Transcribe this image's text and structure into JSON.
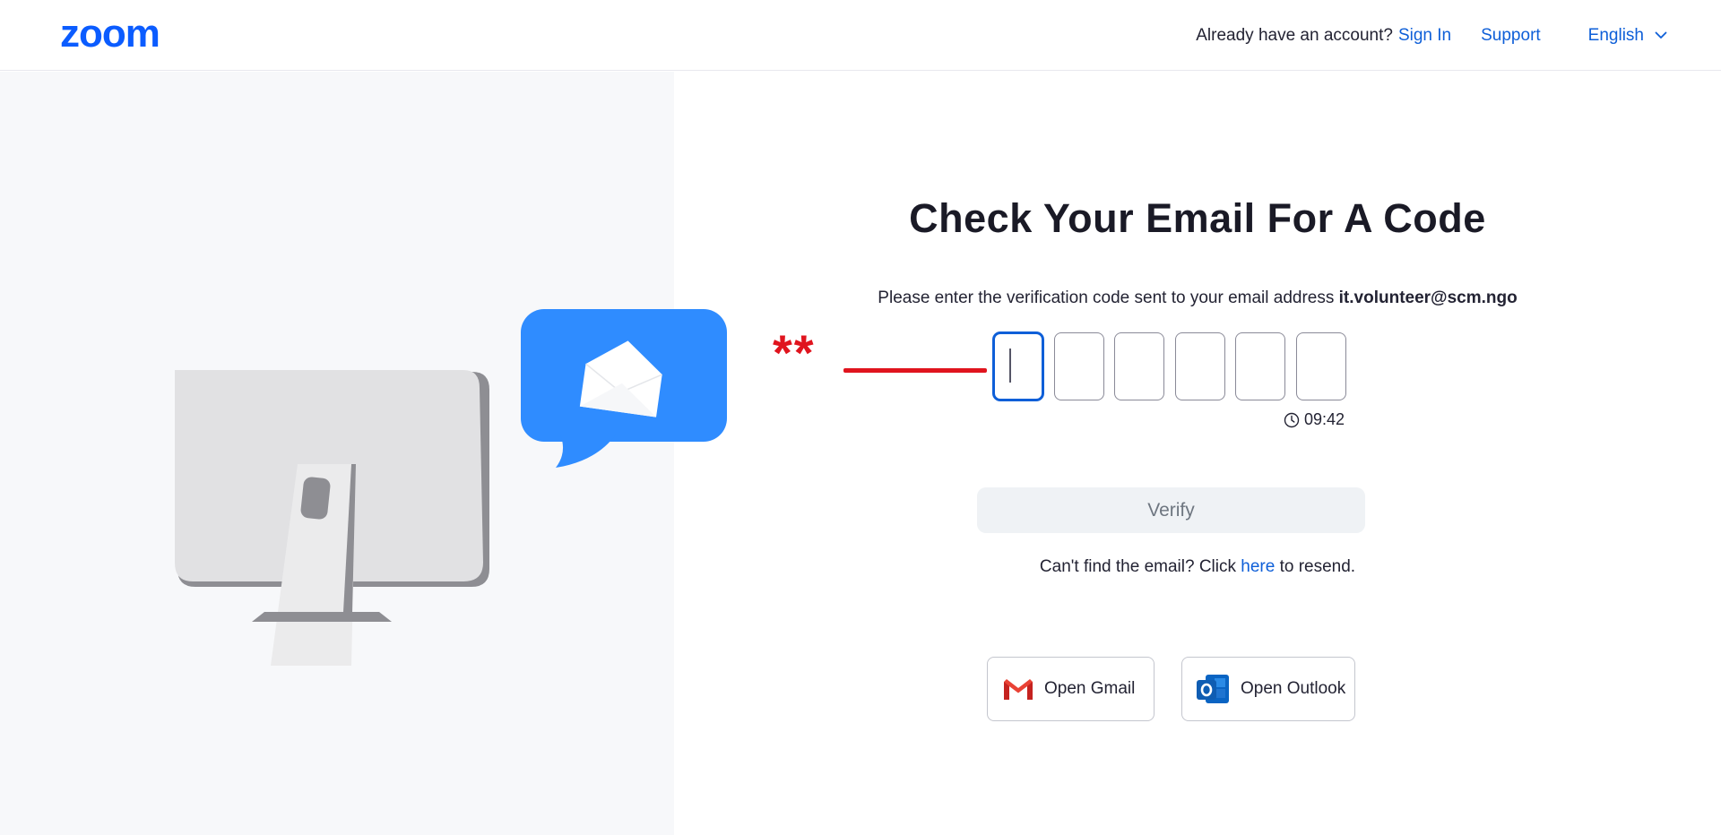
{
  "header": {
    "logo_text": "zoom",
    "account_prompt": "Already have an account?",
    "sign_in": "Sign In",
    "support": "Support",
    "language": "English"
  },
  "main": {
    "title": "Check Your Email For A Code",
    "instruction": "Please enter the verification code sent to your email address",
    "email": "it.volunteer@scm.ngo",
    "annotation": "**",
    "code_length": 6,
    "timer": "09:42",
    "verify_label": "Verify",
    "resend_prefix": "Can't find the email? Click",
    "resend_link": "here",
    "resend_suffix": "to resend.",
    "open_gmail": "Open Gmail",
    "open_outlook": "Open Outlook"
  },
  "colors": {
    "brand": "#0b5cff",
    "link": "#0e5fd8",
    "annotation_red": "#e0141e",
    "illustration_blue": "#2f8cff"
  },
  "icons": {
    "logo": "zoom-logo",
    "language": "chevron-down-icon",
    "timer": "clock-icon",
    "gmail": "gmail-icon",
    "outlook": "outlook-icon"
  }
}
